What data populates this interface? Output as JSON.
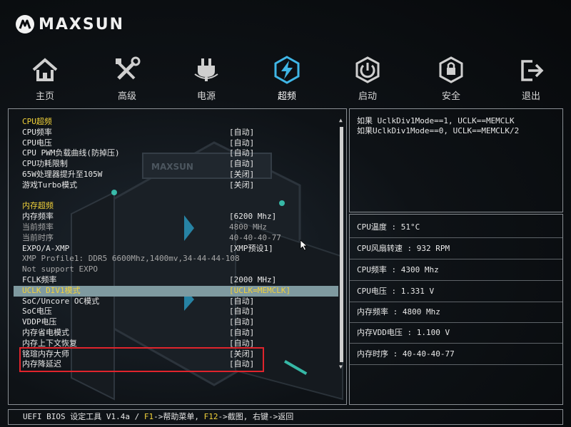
{
  "brand": "MAXSUN",
  "nav": [
    {
      "label": "主页",
      "icon": "home-icon"
    },
    {
      "label": "高级",
      "icon": "tools-icon"
    },
    {
      "label": "电源",
      "icon": "power-plug-icon"
    },
    {
      "label": "超频",
      "icon": "lightning-icon",
      "active": true
    },
    {
      "label": "启动",
      "icon": "power-icon"
    },
    {
      "label": "安全",
      "icon": "shield-icon"
    },
    {
      "label": "退出",
      "icon": "exit-icon"
    }
  ],
  "settings": [
    {
      "name": "CPU超频",
      "value": "",
      "type": "section"
    },
    {
      "name": "CPU频率",
      "value": "[自动]"
    },
    {
      "name": "CPU电压",
      "value": "[自动]"
    },
    {
      "name": "CPU PWM负载曲线(防掉压)",
      "value": "[自动]"
    },
    {
      "name": "CPU功耗限制",
      "value": "[自动]"
    },
    {
      "name": "65W处理器提升至105W",
      "value": "[关闭]"
    },
    {
      "name": "游戏Turbo模式",
      "value": "[关闭]"
    },
    {
      "name": "",
      "value": "",
      "type": "gap"
    },
    {
      "name": "内存超频",
      "value": "",
      "type": "section"
    },
    {
      "name": "内存频率",
      "value": "[6200 Mhz]"
    },
    {
      "name": "当前频率",
      "value": "4800 MHz",
      "type": "dim"
    },
    {
      "name": "当前时序",
      "value": "40-40-40-77",
      "type": "dim"
    },
    {
      "name": "EXPO/A-XMP",
      "value": "[XMP预设1]"
    },
    {
      "name": "XMP Profile1: DDR5 6600Mhz,1400mv,34-44-44-108",
      "value": "",
      "type": "dim"
    },
    {
      "name": "Not support EXPO",
      "value": "",
      "type": "dim"
    },
    {
      "name": "FCLK频率",
      "value": "[2000 MHz]"
    },
    {
      "name": "UCLK DIV1模式",
      "value": "[UCLK=MEMCLK]",
      "type": "sel"
    },
    {
      "name": "SoC/Uncore OC模式",
      "value": "[自动]"
    },
    {
      "name": "SoC电压",
      "value": "[自动]"
    },
    {
      "name": "VDDP电压",
      "value": "[自动]"
    },
    {
      "name": "内存省电模式",
      "value": "[自动]"
    },
    {
      "name": "内存上下文恢复",
      "value": "[自动]"
    },
    {
      "name": "铭瑄内存大师",
      "value": "[关闭]"
    },
    {
      "name": "内存降延迟",
      "value": "[自动]"
    }
  ],
  "help_lines": [
    "如果 UclkDiv1Mode==1, UCLK==MEMCLK",
    "如果UclkDiv1Mode==0, UCLK==MEMCLK/2"
  ],
  "info": [
    {
      "text": "CPU温度 : 51°C"
    },
    {
      "text": "CPU风扇转速 : 932 RPM"
    },
    {
      "text": "CPU频率 : 4300 Mhz"
    },
    {
      "text": "CPU电压 : 1.331 V"
    },
    {
      "text": "内存频率 : 4800 Mhz"
    },
    {
      "text": "内存VDD电压 : 1.100 V"
    },
    {
      "text": "内存时序 : 40-40-40-77"
    }
  ],
  "status": {
    "prefix": "UEFI BIOS 设定工具 V1.4a / ",
    "key1": "F1",
    "desc1": "->帮助菜单, ",
    "key2": "F12",
    "desc2": "->截图, 右键->返回"
  },
  "colors": {
    "accent": "#f2d23a",
    "selected_row": "#7f9aa0",
    "highlight_box": "#e0242c",
    "active_icon": "#3fb6e6"
  }
}
